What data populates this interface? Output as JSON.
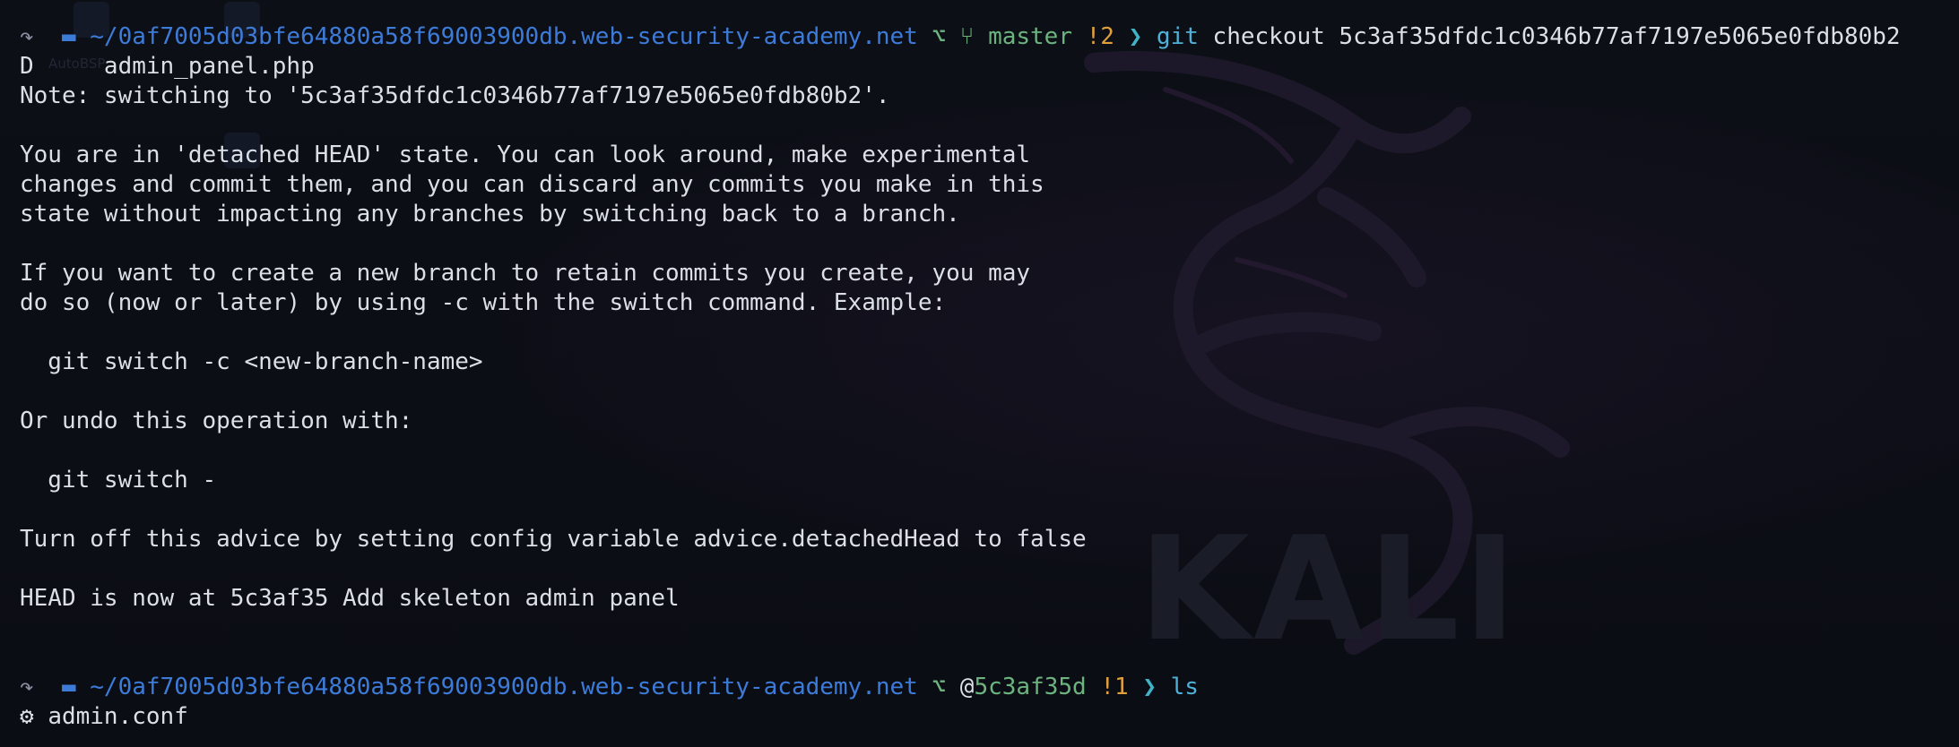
{
  "prompt1": {
    "arrow": "↷",
    "path": "~/0af7005d03bfe64880a58f69003900db.web-security-academy.net",
    "branch": "master",
    "status": "!2",
    "chevron": "❯",
    "command": "git",
    "args": "checkout 5c3af35dfdc1c0346b77af7197e5065e0fdb80b2"
  },
  "output_lines": [
    "D     admin_panel.php",
    "Note: switching to '5c3af35dfdc1c0346b77af7197e5065e0fdb80b2'.",
    "",
    "You are in 'detached HEAD' state. You can look around, make experimental",
    "changes and commit them, and you can discard any commits you make in this",
    "state without impacting any branches by switching back to a branch.",
    "",
    "If you want to create a new branch to retain commits you create, you may",
    "do so (now or later) by using -c with the switch command. Example:",
    "",
    "  git switch -c <new-branch-name>",
    "",
    "Or undo this operation with:",
    "",
    "  git switch -",
    "",
    "Turn off this advice by setting config variable advice.detachedHead to false",
    "",
    "HEAD is now at 5c3af35 Add skeleton admin panel"
  ],
  "prompt2": {
    "arrow": "↷",
    "path": "~/0af7005d03bfe64880a58f69003900db.web-security-academy.net",
    "at": "@",
    "commit": "5c3af35d",
    "status": "!1",
    "chevron": "❯",
    "command": "ls"
  },
  "ls_output": {
    "icon": "gear-icon",
    "file": "admin.conf"
  },
  "wallpaper": {
    "brand_text": "KALI",
    "ghost_label": "AutoBSP"
  },
  "colors": {
    "background": "#0c0e15",
    "path": "#3d7bd9",
    "branch": "#6cb37e",
    "status": "#e0a03a",
    "command": "#4fb0d8",
    "text": "#dcdfe6"
  }
}
